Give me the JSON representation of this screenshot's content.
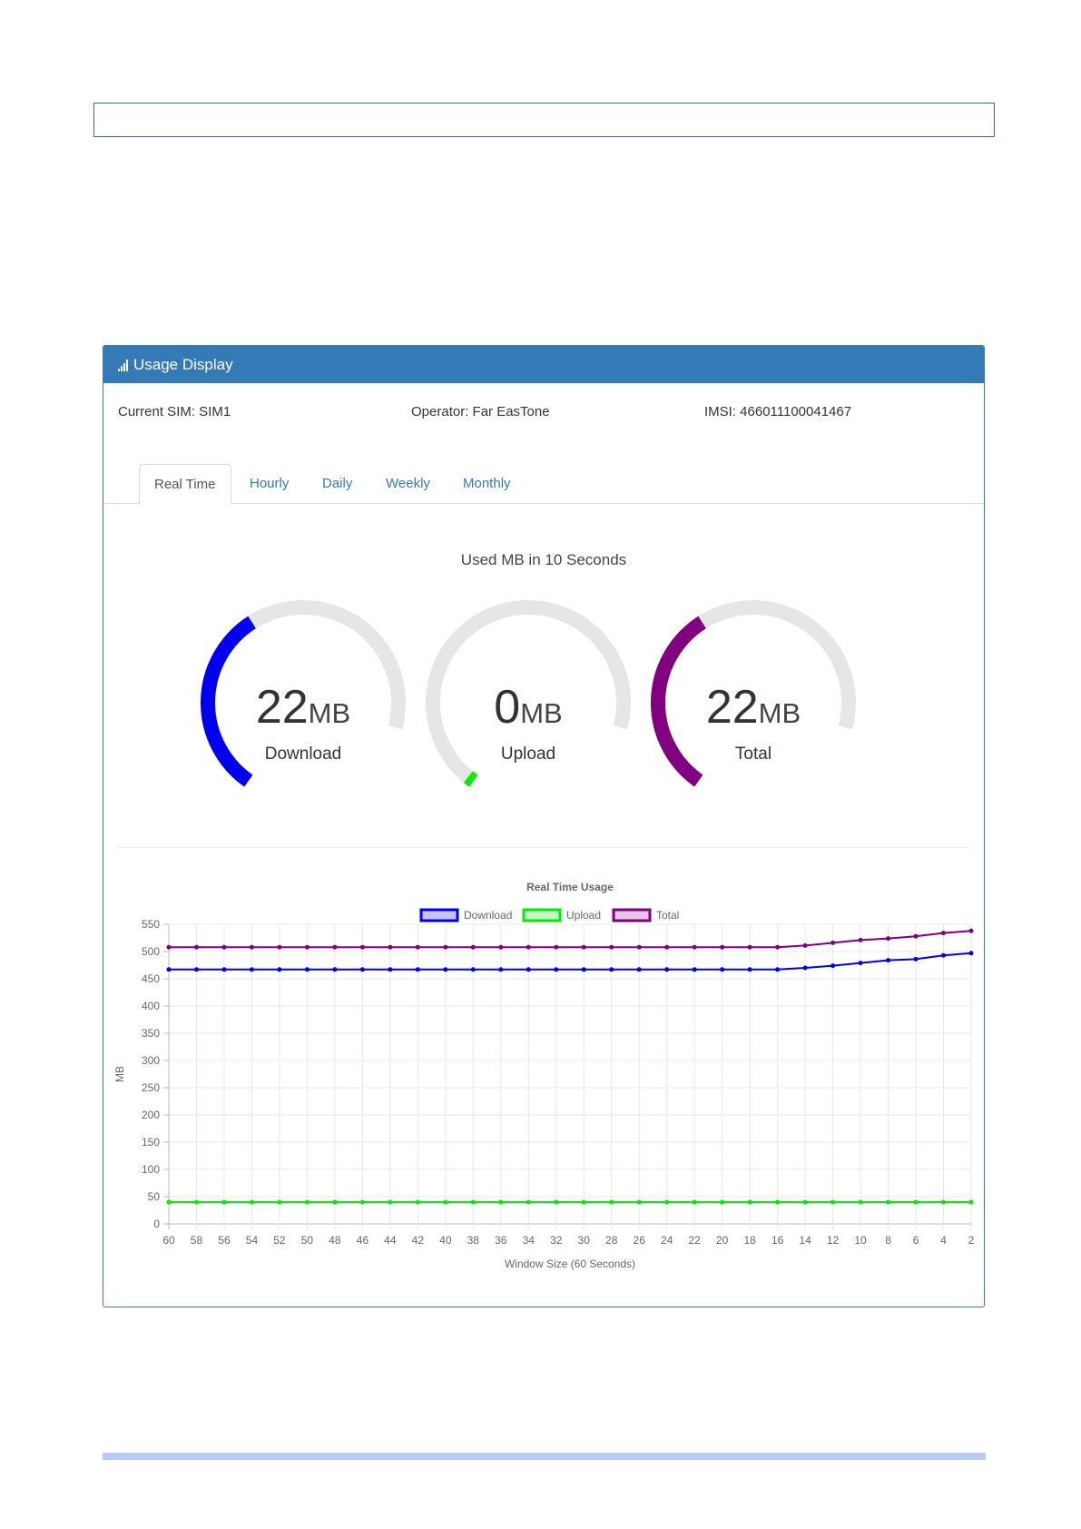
{
  "panel": {
    "title": "Usage Display",
    "header_icon": "signal-bars-icon",
    "current_sim": "Current SIM: SIM1",
    "operator": "Operator: Far EasTone",
    "imsi": "IMSI: 466011100041467"
  },
  "tabs": [
    {
      "label": "Real Time",
      "active": true
    },
    {
      "label": "Hourly",
      "active": false
    },
    {
      "label": "Daily",
      "active": false
    },
    {
      "label": "Weekly",
      "active": false
    },
    {
      "label": "Monthly",
      "active": false
    }
  ],
  "gauges": {
    "title": "Used MB in 10 Seconds",
    "items": [
      {
        "value": "22",
        "unit": "MB",
        "label": "Download",
        "fraction": 0.45,
        "color": "#0000ee"
      },
      {
        "value": "0",
        "unit": "MB",
        "label": "Upload",
        "fraction": 0.0,
        "color": "#00ee00"
      },
      {
        "value": "22",
        "unit": "MB",
        "label": "Total",
        "fraction": 0.45,
        "color": "#800080"
      }
    ],
    "track_color": "#e6e6e6"
  },
  "chart_data": {
    "type": "line",
    "title": "Real Time Usage",
    "xlabel": "Window Size (60 Seconds)",
    "ylabel": "MB",
    "ylim": [
      0,
      550
    ],
    "yticks": [
      0,
      50,
      100,
      150,
      200,
      250,
      300,
      350,
      400,
      450,
      500,
      550
    ],
    "x": [
      60,
      58,
      56,
      54,
      52,
      50,
      48,
      46,
      44,
      42,
      40,
      38,
      36,
      34,
      32,
      30,
      28,
      26,
      24,
      22,
      20,
      18,
      16,
      14,
      12,
      10,
      8,
      6,
      4,
      2
    ],
    "legend_position": "top",
    "grid": true,
    "series": [
      {
        "name": "Download",
        "color": "#0000ee",
        "fill": "#c4c4f8",
        "values": [
          467,
          467,
          467,
          467,
          467,
          467,
          467,
          467,
          467,
          467,
          467,
          467,
          467,
          467,
          467,
          467,
          467,
          467,
          467,
          467,
          467,
          467,
          467,
          470,
          474,
          479,
          484,
          486,
          493,
          497
        ]
      },
      {
        "name": "Upload",
        "color": "#00ee00",
        "fill": "#c6f6c6",
        "values": [
          40,
          40,
          40,
          40,
          40,
          40,
          40,
          40,
          40,
          40,
          40,
          40,
          40,
          40,
          40,
          40,
          40,
          40,
          40,
          40,
          40,
          40,
          40,
          40,
          40,
          40,
          40,
          40,
          40,
          40
        ]
      },
      {
        "name": "Total",
        "color": "#800080",
        "fill": "#e6c6e6",
        "values": [
          508,
          508,
          508,
          508,
          508,
          508,
          508,
          508,
          508,
          508,
          508,
          508,
          508,
          508,
          508,
          508,
          508,
          508,
          508,
          508,
          508,
          508,
          508,
          511,
          516,
          521,
          524,
          528,
          534,
          538
        ]
      }
    ]
  }
}
